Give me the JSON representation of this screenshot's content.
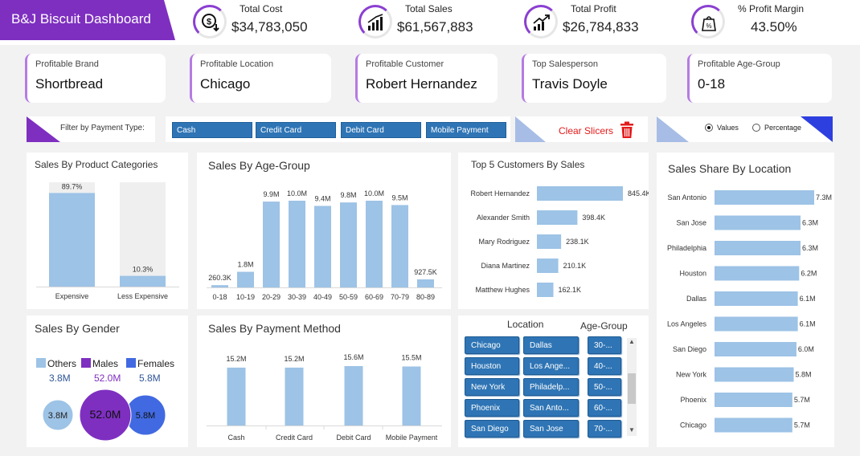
{
  "header": {
    "title": "B&J Biscuit Dashboard"
  },
  "kpis": [
    {
      "label": "Total Cost",
      "value": "$34,783,050",
      "icon": "dollar-down-icon"
    },
    {
      "label": "Total Sales",
      "value": "$61,567,883",
      "icon": "sales-chart-icon"
    },
    {
      "label": "Total Profit",
      "value": "$26,784,833",
      "icon": "profit-trend-icon"
    },
    {
      "label": "% Profit Margin",
      "value": "43.50%",
      "icon": "margin-bag-icon"
    }
  ],
  "highlights": [
    {
      "label": "Profitable Brand",
      "value": "Shortbread"
    },
    {
      "label": "Profitable Location",
      "value": "Chicago"
    },
    {
      "label": "Profitable Customer",
      "value": "Robert Hernandez"
    },
    {
      "label": "Top Salesperson",
      "value": "Travis Doyle"
    },
    {
      "label": "Profitable Age-Group",
      "value": "0-18"
    }
  ],
  "filter": {
    "label": "Filter by Payment Type:",
    "options": [
      "Cash",
      "Credit Card",
      "Debit Card",
      "Mobile Payment"
    ],
    "clear_label": "Clear Slicers",
    "radio_values": "Values",
    "radio_percentage": "Percentage",
    "selected": "Values"
  },
  "colors": {
    "purple": "#7e2fc0",
    "bar": "#9dc3e6",
    "button": "#2f75b5",
    "bar_dark": "#7fb0e0"
  },
  "panels": {
    "categories": "Sales By Product Categories",
    "age": "Sales By Age-Group",
    "customers": "Top 5 Customers By Sales",
    "location": "Sales Share By Location",
    "gender": "Sales By Gender",
    "payment": "Sales By Payment Method"
  },
  "slicer": {
    "location_header": "Location",
    "age_header": "Age-Group",
    "locations_col1": [
      "Chicago",
      "Houston",
      "New York",
      "Phoenix",
      "San Diego"
    ],
    "locations_col2": [
      "Dallas",
      "Los Ange...",
      "Philadelp...",
      "San Anto...",
      "San Jose"
    ],
    "ages": [
      "30-...",
      "40-...",
      "50-...",
      "60-...",
      "70-..."
    ]
  },
  "chart_data": [
    {
      "type": "bar",
      "title": "Sales By Product Categories",
      "categories": [
        "Expensive",
        "Less Expensive"
      ],
      "values": [
        89.7,
        10.3
      ],
      "labels": [
        "89.7%",
        "10.3%"
      ],
      "ylim": [
        0,
        100
      ]
    },
    {
      "type": "bar",
      "title": "Sales By Age-Group",
      "categories": [
        "0-18",
        "10-19",
        "20-29",
        "30-39",
        "40-49",
        "50-59",
        "60-69",
        "70-79",
        "80-89"
      ],
      "values": [
        260300,
        1800000,
        9900000,
        10000000,
        9400000,
        9800000,
        10000000,
        9500000,
        927500
      ],
      "labels": [
        "260.3K",
        "1.8M",
        "9.9M",
        "10.0M",
        "9.4M",
        "9.8M",
        "10.0M",
        "9.5M",
        "927.5K"
      ]
    },
    {
      "type": "bar",
      "orientation": "horizontal",
      "title": "Top 5 Customers By Sales",
      "categories": [
        "Robert Hernandez",
        "Alexander Smith",
        "Mary Rodriguez",
        "Diana Martinez",
        "Matthew Hughes"
      ],
      "values": [
        845400,
        398400,
        238100,
        210100,
        162100
      ],
      "labels": [
        "845.4K",
        "398.4K",
        "238.1K",
        "210.1K",
        "162.1K"
      ]
    },
    {
      "type": "bar",
      "orientation": "horizontal",
      "title": "Sales Share By Location",
      "categories": [
        "San Antonio",
        "San Jose",
        "Philadelphia",
        "Houston",
        "Dallas",
        "Los Angeles",
        "San Diego",
        "New York",
        "Phoenix",
        "Chicago"
      ],
      "values": [
        7300000,
        6300000,
        6300000,
        6200000,
        6100000,
        6100000,
        6000000,
        5800000,
        5700000,
        5700000
      ],
      "labels": [
        "7.3M",
        "6.3M",
        "6.3M",
        "6.2M",
        "6.1M",
        "6.1M",
        "6.0M",
        "5.8M",
        "5.7M",
        "5.7M"
      ]
    },
    {
      "type": "bubble",
      "title": "Sales By Gender",
      "series": [
        {
          "name": "Others",
          "value": 3.8,
          "label": "3.8M",
          "color": "#9dc3e6"
        },
        {
          "name": "Males",
          "value": 52.0,
          "label": "52.0M",
          "color": "#7e2fc0"
        },
        {
          "name": "Females",
          "value": 5.8,
          "label": "5.8M",
          "color": "#4169e1"
        }
      ]
    },
    {
      "type": "bar",
      "title": "Sales By Payment Method",
      "categories": [
        "Cash",
        "Credit Card",
        "Debit Card",
        "Mobile Payment"
      ],
      "values": [
        15200000,
        15200000,
        15600000,
        15500000
      ],
      "labels": [
        "15.2M",
        "15.2M",
        "15.6M",
        "15.5M"
      ]
    }
  ]
}
